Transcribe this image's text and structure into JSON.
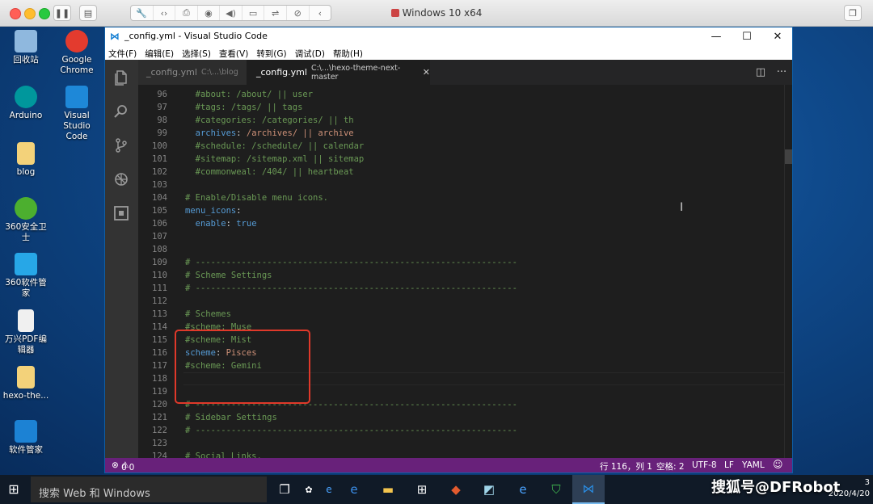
{
  "vm": {
    "title": "Windows 10 x64",
    "toolbar_icons": [
      "wrench-icon",
      "code-arrows-icon",
      "printer-icon",
      "camera-icon",
      "speaker-icon",
      "video-camera-icon",
      "usb-icon",
      "disconnect-icon",
      "chevron-icon"
    ]
  },
  "desktop": {
    "icons": [
      {
        "label": "回收站",
        "color": "#8fb8de"
      },
      {
        "label": "Google Chrome",
        "color": "#e33b2e"
      },
      {
        "label": "Arduino",
        "color": "#00979c"
      },
      {
        "label": "Visual Studio Code",
        "color": "#1e88d8"
      },
      {
        "label": "blog",
        "color": "#f3d27a"
      },
      {
        "label": "360安全卫士",
        "color": "#4caf2f"
      },
      {
        "label": "360软件管家",
        "color": "#27a7e7"
      },
      {
        "label": "万兴PDF编辑器",
        "color": "#f0f0f0"
      },
      {
        "label": "hexo-the...",
        "color": "#f3d27a"
      },
      {
        "label": "软件管家",
        "color": "#1c82d4"
      }
    ]
  },
  "vscode": {
    "window_title": "_config.yml - Visual Studio Code",
    "menu": [
      "文件(F)",
      "编辑(E)",
      "选择(S)",
      "查看(V)",
      "转到(G)",
      "调试(D)",
      "帮助(H)"
    ],
    "tabs": [
      {
        "name": "_config.yml",
        "path": "C:\\...\\blog"
      },
      {
        "name": "_config.yml",
        "path": "C:\\...\\hexo-theme-next-master"
      }
    ],
    "lines": [
      {
        "n": "96",
        "segs": [
          {
            "t": "  #about: /about/ || user",
            "c": "c-com"
          }
        ]
      },
      {
        "n": "97",
        "segs": [
          {
            "t": "  #tags: /tags/ || tags",
            "c": "c-com"
          }
        ]
      },
      {
        "n": "98",
        "segs": [
          {
            "t": "  #categories: /categories/ || th",
            "c": "c-com"
          }
        ]
      },
      {
        "n": "99",
        "segs": [
          {
            "t": "  archives",
            "c": "c-key"
          },
          {
            "t": ": ",
            "c": "c-plain"
          },
          {
            "t": "/archives/ || archive",
            "c": "c-str"
          }
        ]
      },
      {
        "n": "100",
        "segs": [
          {
            "t": "  #schedule: /schedule/ || calendar",
            "c": "c-com"
          }
        ]
      },
      {
        "n": "101",
        "segs": [
          {
            "t": "  #sitemap: /sitemap.xml || sitemap",
            "c": "c-com"
          }
        ]
      },
      {
        "n": "102",
        "segs": [
          {
            "t": "  #commonweal: /404/ || heartbeat",
            "c": "c-com"
          }
        ]
      },
      {
        "n": "103",
        "segs": []
      },
      {
        "n": "104",
        "segs": [
          {
            "t": "# Enable/Disable menu icons.",
            "c": "c-com"
          }
        ]
      },
      {
        "n": "105",
        "segs": [
          {
            "t": "menu_icons",
            "c": "c-key"
          },
          {
            "t": ":",
            "c": "c-plain"
          }
        ]
      },
      {
        "n": "106",
        "segs": [
          {
            "t": "  enable",
            "c": "c-key"
          },
          {
            "t": ": ",
            "c": "c-plain"
          },
          {
            "t": "true",
            "c": "c-bool"
          }
        ]
      },
      {
        "n": "107",
        "segs": []
      },
      {
        "n": "108",
        "segs": []
      },
      {
        "n": "109",
        "segs": [
          {
            "t": "# ---------------------------------------------------------------",
            "c": "c-com"
          }
        ]
      },
      {
        "n": "110",
        "segs": [
          {
            "t": "# Scheme Settings",
            "c": "c-com"
          }
        ]
      },
      {
        "n": "111",
        "segs": [
          {
            "t": "# ---------------------------------------------------------------",
            "c": "c-com"
          }
        ]
      },
      {
        "n": "112",
        "segs": []
      },
      {
        "n": "113",
        "segs": [
          {
            "t": "# Schemes",
            "c": "c-com"
          }
        ]
      },
      {
        "n": "114",
        "segs": [
          {
            "t": "#scheme: Muse",
            "c": "c-com"
          }
        ]
      },
      {
        "n": "115",
        "segs": [
          {
            "t": "#scheme: Mist",
            "c": "c-com"
          }
        ]
      },
      {
        "n": "116",
        "segs": [
          {
            "t": "scheme",
            "c": "c-key"
          },
          {
            "t": ": ",
            "c": "c-plain"
          },
          {
            "t": "Pisces",
            "c": "c-str"
          }
        ]
      },
      {
        "n": "117",
        "segs": [
          {
            "t": "#scheme: Gemini",
            "c": "c-com"
          }
        ]
      },
      {
        "n": "118",
        "segs": []
      },
      {
        "n": "119",
        "segs": []
      },
      {
        "n": "120",
        "segs": [
          {
            "t": "# ---------------------------------------------------------------",
            "c": "c-com"
          }
        ]
      },
      {
        "n": "121",
        "segs": [
          {
            "t": "# Sidebar Settings",
            "c": "c-com"
          }
        ]
      },
      {
        "n": "122",
        "segs": [
          {
            "t": "# ---------------------------------------------------------------",
            "c": "c-com"
          }
        ]
      },
      {
        "n": "123",
        "segs": []
      },
      {
        "n": "124",
        "segs": [
          {
            "t": "# Social Links.",
            "c": "c-com"
          }
        ]
      }
    ],
    "status": {
      "errors": "0",
      "warnings": "0",
      "position": "行 116，列 1",
      "spaces": "空格: 2",
      "encoding": "UTF-8",
      "eol": "LF",
      "language": "YAML"
    }
  },
  "taskbar": {
    "search_placeholder": "搜索 Web 和 Windows",
    "date": "2020/4/20",
    "time": "3"
  },
  "watermark": "搜狐号@DFRobot",
  "colors": {
    "statusbar": "#68217a",
    "highlight_box": "#e0392a",
    "comment": "#6a9955",
    "key": "#569cd6",
    "string": "#ce9178"
  }
}
